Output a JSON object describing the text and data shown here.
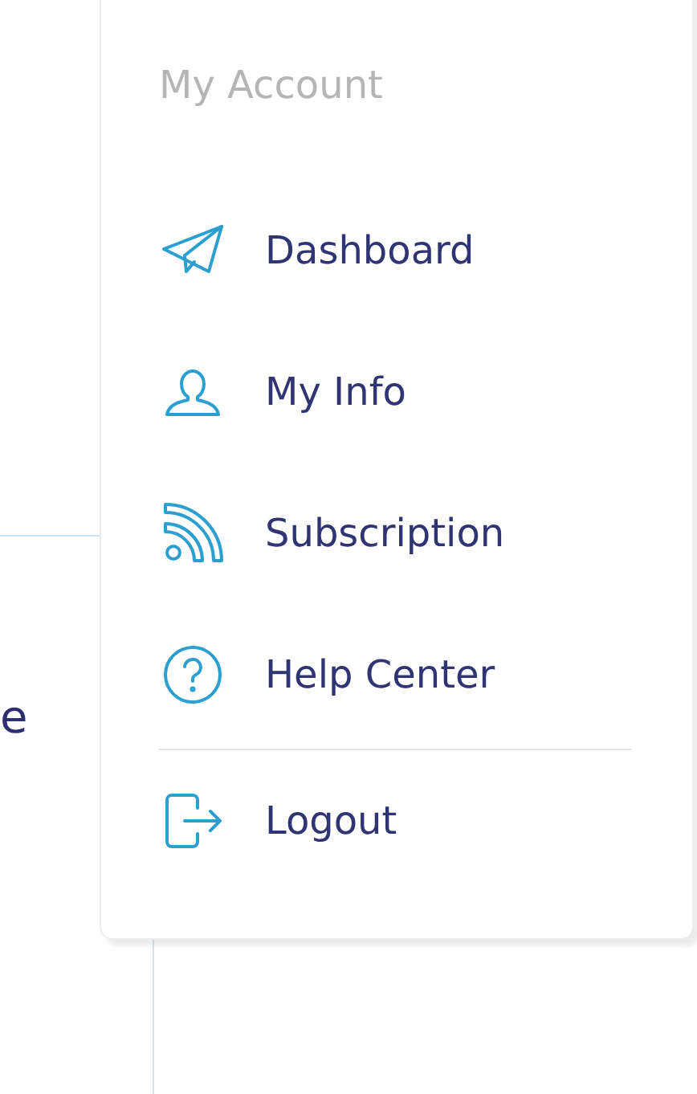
{
  "background": {
    "text_fragment": "e"
  },
  "menu": {
    "title": "My Account",
    "items": [
      {
        "kind": "send",
        "label": "Dashboard"
      },
      {
        "kind": "user",
        "label": "My Info"
      },
      {
        "kind": "feed",
        "label": "Subscription"
      },
      {
        "kind": "help",
        "label": "Help Center"
      }
    ],
    "footer_items": [
      {
        "kind": "logout",
        "label": "Logout"
      }
    ]
  }
}
